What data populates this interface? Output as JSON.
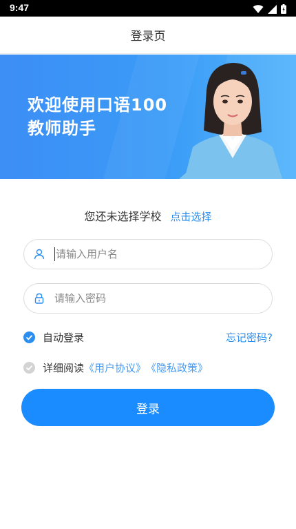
{
  "status_bar": {
    "time": "9:47"
  },
  "nav": {
    "title": "登录页"
  },
  "banner": {
    "line1": "欢迎使用口语100",
    "line2": "教师助手"
  },
  "school": {
    "text": "您还未选择学校",
    "link": "点击选择"
  },
  "form": {
    "username_placeholder": "请输入用户名",
    "password_placeholder": "请输入密码"
  },
  "auto_login": {
    "label": "自动登录",
    "checked": true
  },
  "forgot_password": "忘记密码?",
  "agreement": {
    "prefix": "详细阅读",
    "user_agreement": "《用户协议》",
    "privacy_policy": "《隐私政策》",
    "checked": false
  },
  "login_button": "登录",
  "colors": {
    "accent": "#1a8cff",
    "link": "#2b8ef0",
    "banner": "#3d8ef5"
  }
}
